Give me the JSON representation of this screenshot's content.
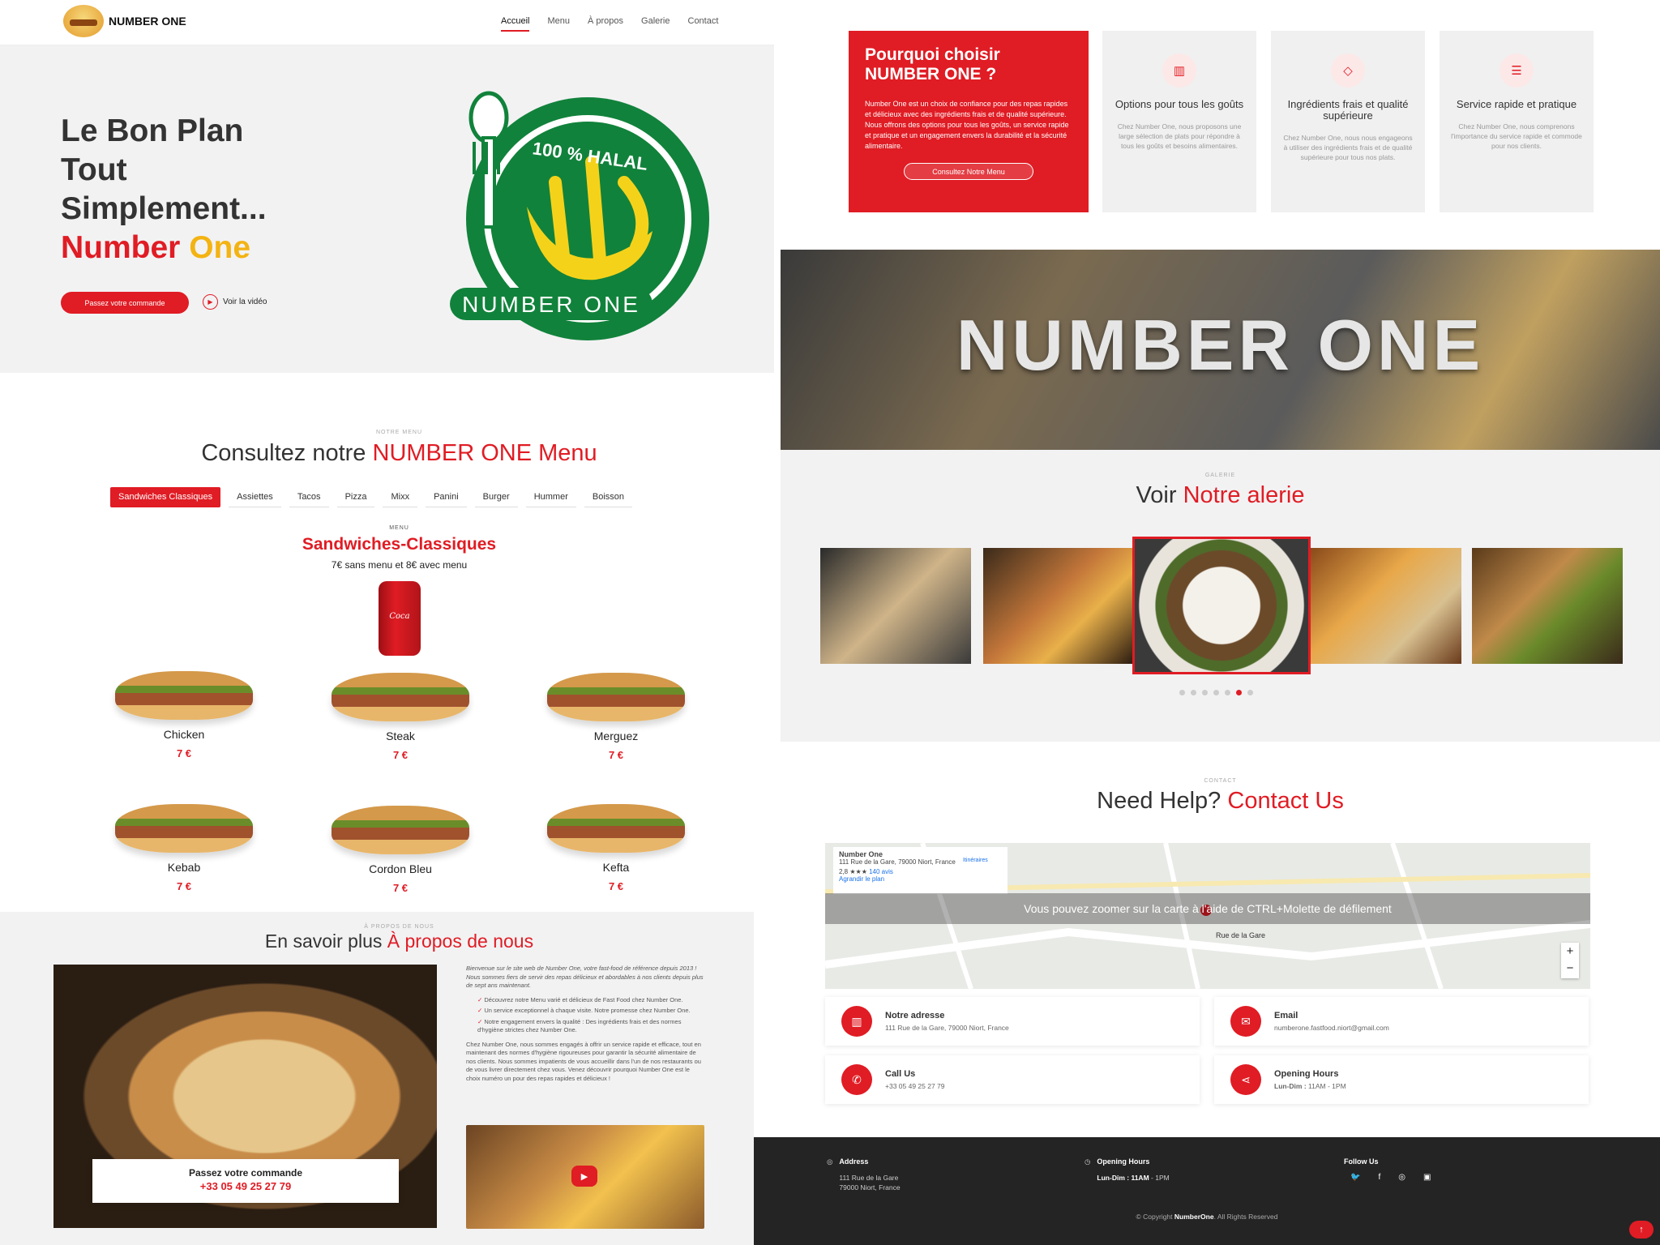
{
  "nav": {
    "brand": "NUMBER ONE",
    "links": [
      "Accueil",
      "Menu",
      "À propos",
      "Galerie",
      "Contact"
    ],
    "active": "Accueil"
  },
  "hero": {
    "line1": "Le Bon Plan",
    "line2": "Tout",
    "line3": "Simplement...",
    "brand_a": "Number",
    "brand_b": "One",
    "order_label": "Passez votre commande",
    "video_label": "Voir la vidéo",
    "badge_top": "100 % HALAL",
    "badge_bottom": "NUMBER ONE"
  },
  "menu": {
    "eyebrow": "NOTRE MENU",
    "title_a": "Consultez notre",
    "title_b": "NUMBER ONE Menu",
    "tabs": [
      "Sandwiches Classiques",
      "Assiettes",
      "Tacos",
      "Pizza",
      "Mixx",
      "Panini",
      "Burger",
      "Hummer",
      "Boisson"
    ],
    "sub_eyebrow": "MENU",
    "category": "Sandwiches-Classiques",
    "price_note": "7€ sans menu et 8€ avec menu",
    "items": [
      {
        "name": "Chicken",
        "price": "7 €"
      },
      {
        "name": "Steak",
        "price": "7 €"
      },
      {
        "name": "Merguez",
        "price": "7 €"
      },
      {
        "name": "Kebab",
        "price": "7 €"
      },
      {
        "name": "Cordon Bleu",
        "price": "7 €"
      },
      {
        "name": "Kefta",
        "price": "7 €"
      }
    ]
  },
  "about": {
    "eyebrow": "À PROPOS DE NOUS",
    "title_a": "En savoir plus",
    "title_b": "À propos de nous",
    "call_label": "Passez votre commande",
    "call_phone": "+33 05 49 25 27 79",
    "intro": "Bienvenue sur le site web de Number One, votre fast-food de référence depuis 2013 ! Nous sommes fiers de servir des repas délicieux et abordables à nos clients depuis plus de sept ans maintenant.",
    "bullets": [
      "Découvrez notre Menu varié et délicieux de Fast Food chez Number One.",
      "Un service exceptionnel à chaque visite. Notre promesse chez Number One.",
      "Notre engagement envers la qualité : Des ingrédients frais et des normes d'hygiène strictes chez Number One."
    ],
    "outro": "Chez Number One, nous sommes engagés à offrir un service rapide et efficace, tout en maintenant des normes d'hygiène rigoureuses pour garantir la sécurité alimentaire de nos clients. Nous sommes impatients de vous accueillir dans l'un de nos restaurants ou de vous livrer directement chez vous. Venez découvrir pourquoi Number One est le choix numéro un pour des repas rapides et délicieux !"
  },
  "why": {
    "title": "Pourquoi choisir NUMBER ONE ?",
    "body": "Number One est un choix de confiance pour des repas rapides et délicieux avec des ingrédients frais et de qualité supérieure. Nous offrons des options pour tous les goûts, un service rapide et pratique et un engagement envers la durabilité et la sécurité alimentaire.",
    "button": "Consultez Notre Menu",
    "features": [
      {
        "icon": "chart-icon",
        "glyph": "▥",
        "title": "Options pour tous les goûts",
        "body": "Chez Number One, nous proposons une large sélection de plats pour répondre à tous les goûts et besoins alimentaires."
      },
      {
        "icon": "diamond-icon",
        "glyph": "◇",
        "title": "Ingrédients frais et qualité supérieure",
        "body": "Chez Number One, nous nous engageons à utiliser des ingrédients frais et de qualité supérieure pour tous nos plats."
      },
      {
        "icon": "burger-icon",
        "glyph": "☰",
        "title": "Service rapide et pratique",
        "body": "Chez Number One, nous comprenons l'importance du service rapide et commode pour nos clients."
      }
    ]
  },
  "banner": {
    "text": "NUMBER ONE"
  },
  "gallery": {
    "eyebrow": "GALERIE",
    "title_a": "Voir",
    "title_b": "Notre alerie",
    "dots": 7,
    "active_dot": 5
  },
  "contact": {
    "eyebrow": "CONTACT",
    "title_a": "Need Help?",
    "title_b": "Contact Us",
    "map_name": "Number One",
    "map_address": "111 Rue de la Gare, 79000 Niort, France",
    "map_rating": "2,8 ★★★",
    "map_reviews": "140 avis",
    "map_directions": "Itinéraires",
    "map_larger": "Agrandir le plan",
    "map_hint": "Vous pouvez zoomer sur la carte à l'aide de CTRL+Molette de défilement",
    "map_street": "Rue de la Gare",
    "zoom_in": "+",
    "zoom_out": "−",
    "cards": [
      {
        "icon": "map-icon",
        "glyph": "▥",
        "title": "Notre adresse",
        "text": "111 Rue de la Gare, 79000 Niort, France"
      },
      {
        "icon": "envelope-icon",
        "glyph": "✉",
        "title": "Email",
        "text": "numberone.fastfood.niort@gmail.com"
      },
      {
        "icon": "phone-icon",
        "glyph": "✆",
        "title": "Call Us",
        "text": "+33 05 49 25 27 79"
      },
      {
        "icon": "share-icon",
        "glyph": "⋖",
        "title": "Opening Hours",
        "text_bold": "Lun-Dim :",
        "text": "11AM - 1PM"
      }
    ]
  },
  "footer": {
    "address_title": "Address",
    "address_line1": "111 Rue de la Gare",
    "address_line2": "79000 Niort, France",
    "hours_title": "Opening Hours",
    "hours_bold": "Lun-Dim : 11AM",
    "hours_rest": "- 1PM",
    "follow_title": "Follow Us",
    "social": [
      {
        "icon": "twitter-icon",
        "glyph": "🐦"
      },
      {
        "icon": "facebook-icon",
        "glyph": "f"
      },
      {
        "icon": "instagram-icon",
        "glyph": "◎"
      },
      {
        "icon": "linkedin-icon",
        "glyph": "▣"
      }
    ],
    "copyright_a": "© Copyright",
    "copyright_b": "NumberOne",
    "copyright_c": ". All Rights Reserved",
    "to_top": "↑"
  }
}
